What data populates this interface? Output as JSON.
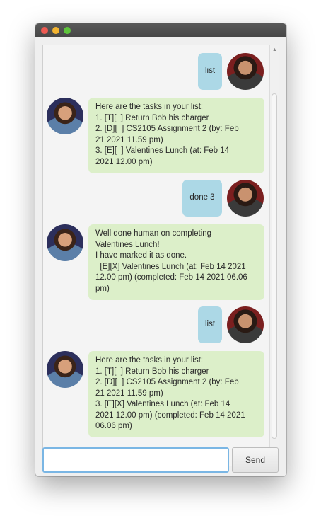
{
  "window": {
    "controls": [
      "close",
      "minimize",
      "maximize"
    ]
  },
  "messages": [
    {
      "sender": "user",
      "lines": [
        "list"
      ]
    },
    {
      "sender": "bot",
      "lines": [
        "Here are the tasks in your list:",
        "1. [T][  ] Return Bob his charger",
        "2. [D][  ] CS2105 Assignment 2 (by: Feb",
        "21 2021 11.59 pm)",
        "3. [E][  ] Valentines Lunch (at: Feb 14",
        "2021 12.00 pm)"
      ]
    },
    {
      "sender": "user",
      "lines": [
        "done 3"
      ]
    },
    {
      "sender": "bot",
      "lines": [
        "Well done human on completing",
        "Valentines Lunch!",
        "I have marked it as done.",
        "  [E][X] Valentines Lunch (at: Feb 14 2021",
        "12.00 pm) (completed: Feb 14 2021 06.06",
        "pm)"
      ]
    },
    {
      "sender": "user",
      "lines": [
        "list"
      ]
    },
    {
      "sender": "bot",
      "lines": [
        "Here are the tasks in your list:",
        "1. [T][  ] Return Bob his charger",
        "2. [D][  ] CS2105 Assignment 2 (by: Feb",
        "21 2021 11.59 pm)",
        "3. [E][X] Valentines Lunch (at: Feb 14",
        "2021 12.00 pm) (completed: Feb 14 2021",
        "06.06 pm)"
      ]
    }
  ],
  "input": {
    "value": "",
    "placeholder": ""
  },
  "send_button": {
    "label": "Send"
  },
  "colors": {
    "user_bubble": "#acd8e6",
    "bot_bubble": "#dcefc9",
    "input_focus_border": "#7ab6e4"
  }
}
